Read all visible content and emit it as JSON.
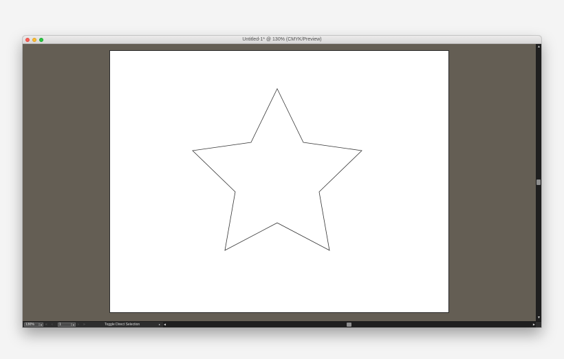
{
  "window": {
    "title": "Untitled-1* @ 130% (CMYK/Preview)"
  },
  "statusbar": {
    "zoom_value": "130%",
    "page_value": "1",
    "status_text": "Toggle Direct Selection",
    "nav_first": "«",
    "nav_prev": "‹",
    "nav_next": "›",
    "nav_last": "»",
    "dropdown_glyph": "▼",
    "arrow_glyph": "▸"
  },
  "icons": {
    "close": "close-traffic-light",
    "minimize": "minimize-traffic-light",
    "maximize": "maximize-traffic-light",
    "scroll_up": "▲",
    "scroll_down": "▼",
    "scroll_left": "◀",
    "scroll_right": "▶"
  },
  "artwork": {
    "shape": "star",
    "stroke_color": "#333333",
    "fill_color": "#ffffff"
  },
  "colors": {
    "pasteboard": "#645e54",
    "artboard": "#ffffff",
    "statusbar": "#2e2e2e"
  }
}
